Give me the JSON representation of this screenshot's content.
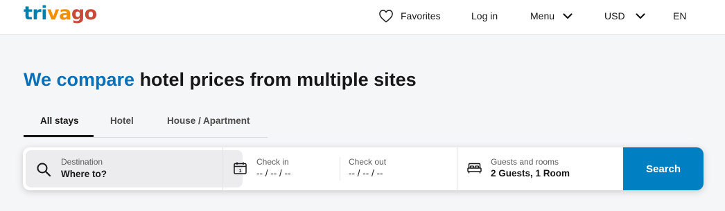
{
  "brand": {
    "logo_part1": "tri",
    "logo_part2": "va",
    "logo_part3": "go"
  },
  "header": {
    "favorites_label": "Favorites",
    "login_label": "Log in",
    "menu_label": "Menu",
    "currency_label": "USD",
    "language_label": "EN"
  },
  "hero": {
    "title_accent": "We compare",
    "title_rest": " hotel prices from multiple sites"
  },
  "tabs": [
    {
      "label": "All stays",
      "active": true
    },
    {
      "label": "Hotel",
      "active": false
    },
    {
      "label": "House / Apartment",
      "active": false
    }
  ],
  "search": {
    "destination_label": "Destination",
    "destination_placeholder": "Where to?",
    "checkin_label": "Check in",
    "checkin_value": "-- / -- / --",
    "checkout_label": "Check out",
    "checkout_value": "-- / -- / --",
    "guests_label": "Guests and rooms",
    "guests_value": "2 Guests, 1 Room",
    "calendar_day": "1",
    "button_label": "Search"
  },
  "colors": {
    "brand_blue": "#007fad",
    "brand_orange": "#f48f00",
    "brand_red": "#c94a38",
    "accent_text": "#0a70b8",
    "search_button": "#007fc3"
  },
  "icons": [
    "heart-icon",
    "chevron-down-icon",
    "search-icon",
    "calendar-icon",
    "bed-icon"
  ]
}
